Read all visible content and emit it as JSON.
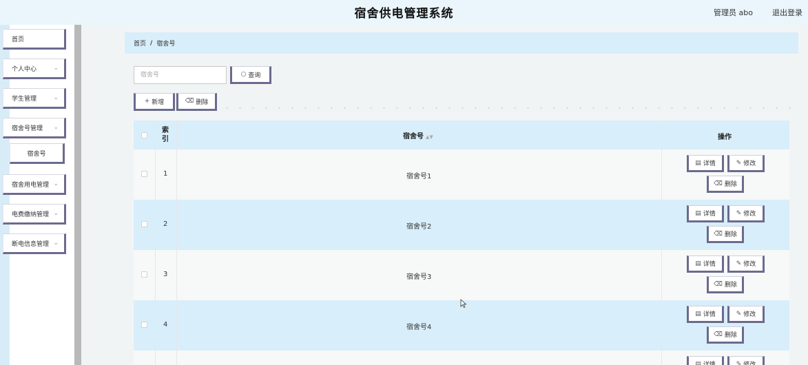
{
  "header": {
    "title": "宿舍供电管理系统",
    "user": "管理员 abo",
    "logout": "退出登录"
  },
  "sidebar": {
    "items": [
      {
        "label": "首页"
      },
      {
        "label": "个人中心"
      },
      {
        "label": "学生管理"
      },
      {
        "label": "宿舍号管理"
      },
      {
        "label": "宿舍号"
      },
      {
        "label": "宿舍用电管理"
      },
      {
        "label": "电费缴纳管理"
      },
      {
        "label": "断电信息管理"
      }
    ]
  },
  "breadcrumb": {
    "home": "首页",
    "separator": "/",
    "current": "宿舍号"
  },
  "search": {
    "placeholder": "宿舍号",
    "button_label": "查询"
  },
  "toolbar": {
    "add_label": "新增",
    "delete_label": "删除"
  },
  "table": {
    "headers": {
      "index": "索\n引",
      "dorm": "宿舍号",
      "actions": "操作"
    },
    "rows": [
      {
        "index": "1",
        "dorm": "宿舍号1"
      },
      {
        "index": "2",
        "dorm": "宿舍号2"
      },
      {
        "index": "3",
        "dorm": "宿舍号3"
      },
      {
        "index": "4",
        "dorm": "宿舍号4"
      }
    ],
    "actions": {
      "detail": "详情",
      "edit": "修改",
      "delete": "删除"
    }
  },
  "colors": {
    "header_bg": "#eaf6fc",
    "accent_border": "#6b6a8e",
    "row_highlight": "#d8eefa"
  }
}
